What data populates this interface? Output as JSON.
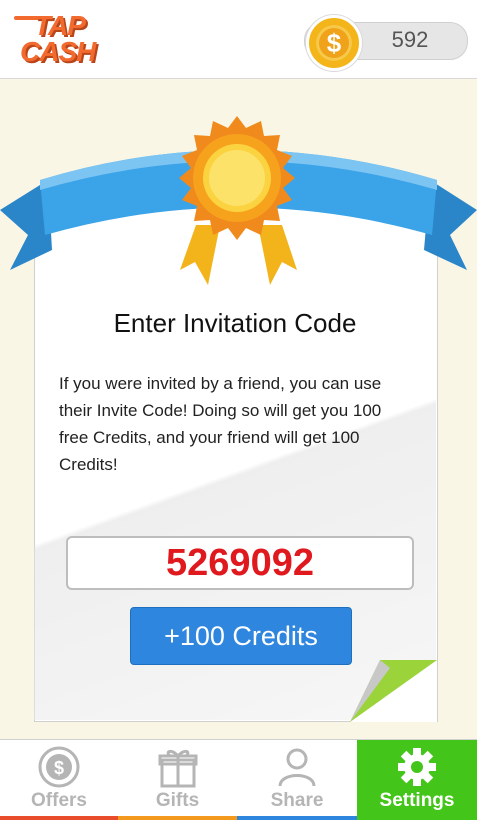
{
  "header": {
    "logo_line1": "TAP",
    "logo_line2": "CASH",
    "coin_symbol": "$",
    "coin_balance": "592"
  },
  "invite": {
    "title": "Enter Invitation Code",
    "description": "If you were invited by a friend, you can use their Invite Code! Doing so will get you 100 free Credits, and your friend will get 100 Credits!",
    "code_value": "5269092",
    "button_label": "+100 Credits"
  },
  "nav": {
    "items": [
      {
        "label": "Offers",
        "icon": "dollar-coin-icon",
        "stripe": "#e84c2a"
      },
      {
        "label": "Gifts",
        "icon": "gift-icon",
        "stripe": "#f39a1e"
      },
      {
        "label": "Share",
        "icon": "person-icon",
        "stripe": "#2e86de"
      },
      {
        "label": "Settings",
        "icon": "gear-icon",
        "stripe": "#44c51a"
      }
    ],
    "active": "Settings"
  },
  "colors": {
    "brand": "#f26a2e",
    "code_text": "#e0191f",
    "button": "#2e86de",
    "active_tab": "#44c51a",
    "ribbon": "#3ba3e8",
    "medal": "#f6a21c"
  }
}
